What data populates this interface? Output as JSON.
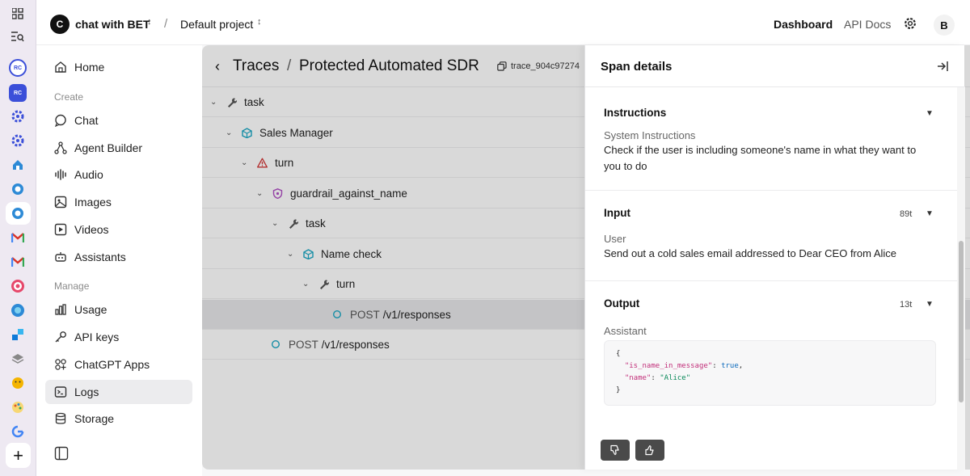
{
  "org": {
    "initial": "C",
    "name": "chat with BET"
  },
  "project": {
    "name": "Default project"
  },
  "topnav": {
    "dashboard": "Dashboard",
    "api_docs": "API Docs",
    "user_initial": "B"
  },
  "rail": {
    "badge_rc": "RC"
  },
  "sidebar": {
    "home": "Home",
    "create_heading": "Create",
    "create_items": [
      "Chat",
      "Agent Builder",
      "Audio",
      "Images",
      "Videos",
      "Assistants"
    ],
    "manage_heading": "Manage",
    "manage_items": [
      "Usage",
      "API keys",
      "ChatGPT Apps",
      "Logs",
      "Storage"
    ],
    "active_item": "Logs"
  },
  "trace": {
    "title": "Traces",
    "separator": "/",
    "name": "Protected Automated SDR",
    "id": "trace_904c97274",
    "rows": [
      {
        "label": "task",
        "method": "",
        "icon": "wrench-icon"
      },
      {
        "label": "Sales Manager",
        "method": "",
        "icon": "cube-icon"
      },
      {
        "label": "turn",
        "method": "",
        "icon": "warning-icon"
      },
      {
        "label": "guardrail_against_name",
        "method": "",
        "icon": "shield-icon"
      },
      {
        "label": "task",
        "method": "",
        "icon": "wrench-icon"
      },
      {
        "label": "Name check",
        "method": "",
        "icon": "cube-icon"
      },
      {
        "label": "turn",
        "method": "",
        "icon": "wrench-icon"
      },
      {
        "label": "/v1/responses",
        "method": "POST",
        "icon": "circle-icon"
      },
      {
        "label": "/v1/responses",
        "method": "POST",
        "icon": "circle-icon"
      }
    ]
  },
  "panel": {
    "title": "Span details",
    "instructions": {
      "title": "Instructions",
      "label": "System Instructions",
      "text": "Check if the user is including someone's name in what they want to you to do"
    },
    "input": {
      "title": "Input",
      "tokens": "89t",
      "label": "User",
      "text": "Send out a cold sales email addressed to Dear CEO from Alice"
    },
    "output": {
      "title": "Output",
      "tokens": "13t",
      "label": "Assistant",
      "code_open": "{",
      "code_key1": "\"is_name_in_message\"",
      "code_val1": "true",
      "code_key2": "\"name\"",
      "code_val2": "\"Alice\"",
      "code_close": "}"
    }
  },
  "colors": {
    "accent_cyan": "#1aa7c4",
    "warning_red": "#d33b3b",
    "shield_purple": "#b04fc4",
    "rail_blue": "#3b4fd9"
  }
}
